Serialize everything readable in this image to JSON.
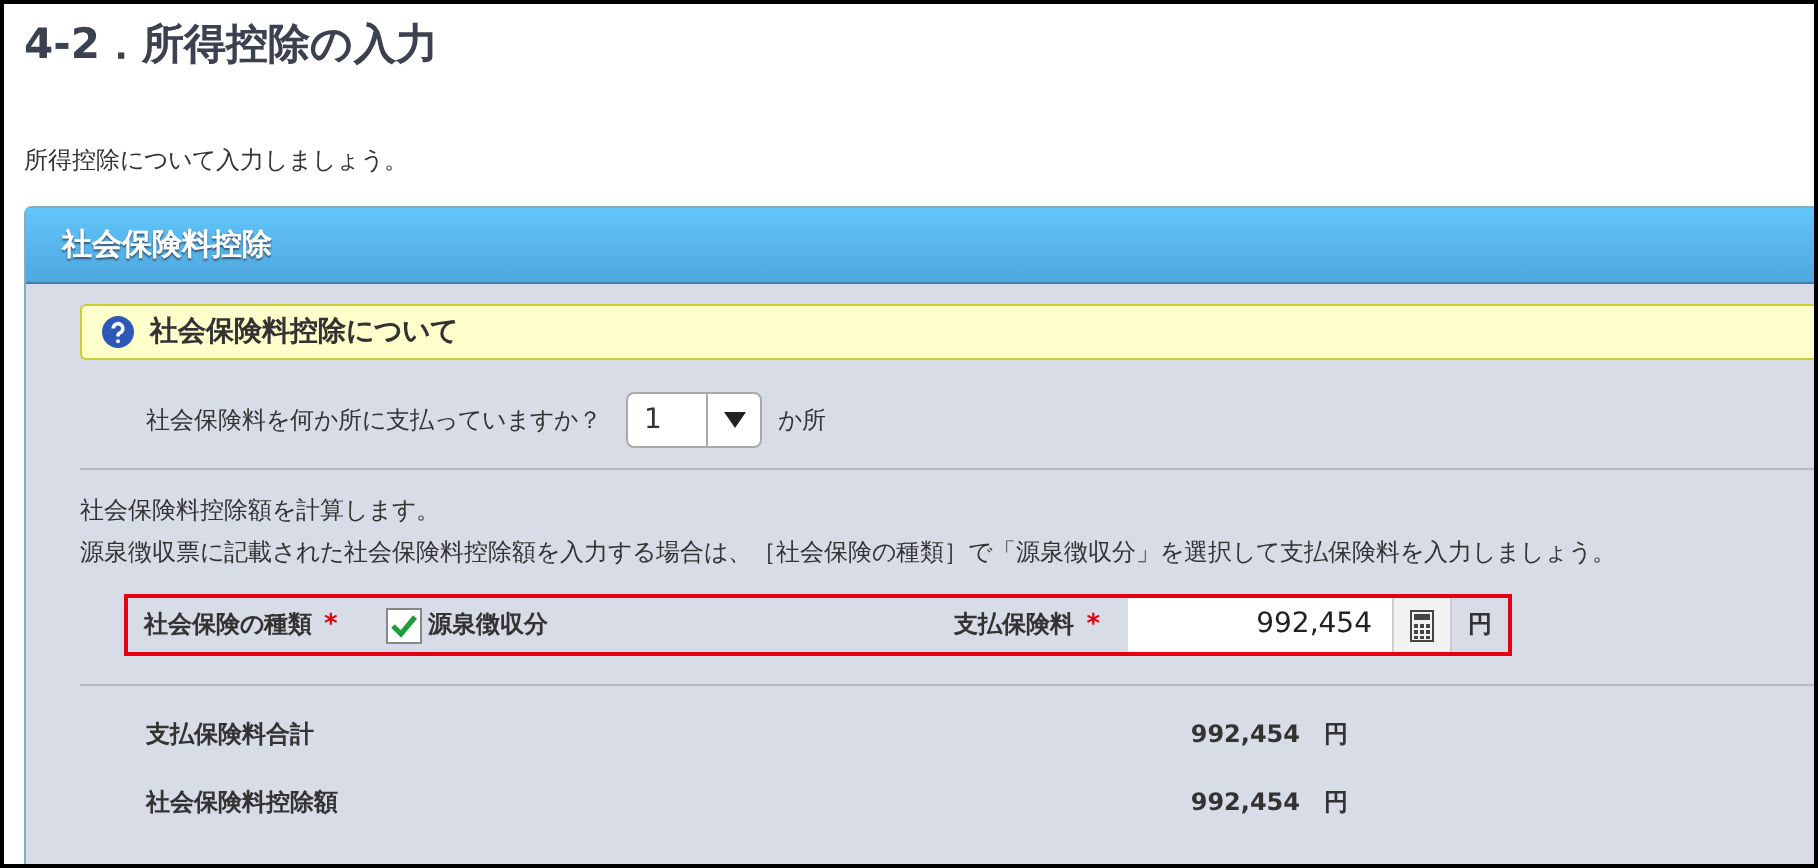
{
  "page_title": "4-2．所得控除の入力",
  "intro": "所得控除について入力しましょう。",
  "panel": {
    "title": "社会保険料控除",
    "info_bar": {
      "text": "社会保険料控除について"
    },
    "count_question": {
      "label": "社会保険料を何か所に支払っていますか？",
      "value": "1",
      "unit": "か所"
    },
    "description": [
      "社会保険料控除額を計算します。",
      "源泉徴収票に記載された社会保険料控除額を入力する場合は、［社会保険の種類］で「源泉徴収分」を選択して支払保険料を入力しましょう。"
    ],
    "entry": {
      "highlighted": true,
      "type_label": "社会保険の種類",
      "type_mark": "*",
      "checkbox": {
        "label": "源泉徴収分",
        "checked": true
      },
      "amount_label": "支払保険料",
      "amount_mark": "*",
      "amount_value": "992,454",
      "unit": "円"
    },
    "summary": [
      {
        "label": "支払保険料合計",
        "value": "992,454",
        "unit": "円"
      },
      {
        "label": "社会保険料控除額",
        "value": "992,454",
        "unit": "円"
      }
    ]
  }
}
